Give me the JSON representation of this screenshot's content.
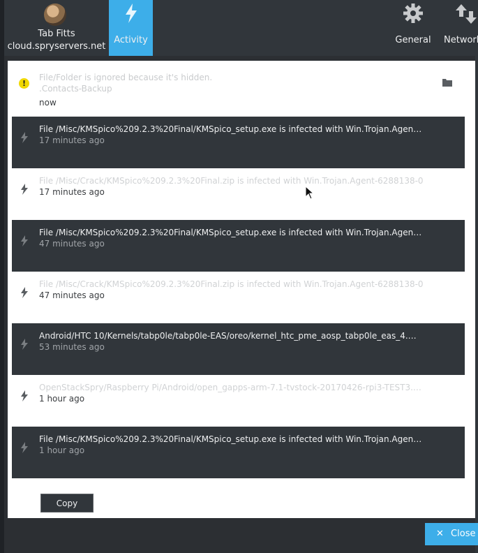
{
  "toolbar": {
    "account_name": "Tab Fitts",
    "account_host": "cloud.spryservers.net",
    "activity_label": "Activity",
    "general_label": "General",
    "network_label": "Network"
  },
  "notice": {
    "line1": "File/Folder is ignored because it's hidden.",
    "line2": ".Contacts-Backup",
    "time": "now",
    "icon": "warning-icon"
  },
  "activities": [
    {
      "title": "File /Misc/KMSpico%209.2.3%20Final/KMSpico_setup.exe is infected with Win.Trojan.Agen…",
      "time": "17 minutes ago",
      "style": "dark"
    },
    {
      "title": "File /Misc/Crack/KMSpico%209.2.3%20Final.zip is infected with Win.Trojan.Agent-6288138-0",
      "time": "17 minutes ago",
      "style": "light"
    },
    {
      "title": "File /Misc/KMSpico%209.2.3%20Final/KMSpico_setup.exe is infected with Win.Trojan.Agen…",
      "time": "47 minutes ago",
      "style": "dark"
    },
    {
      "title": "File /Misc/Crack/KMSpico%209.2.3%20Final.zip is infected with Win.Trojan.Agent-6288138-0",
      "time": "47 minutes ago",
      "style": "light"
    },
    {
      "title": "Android/HTC 10/Kernels/tabp0le/tabp0le-EAS/oreo/kernel_htc_pme_aosp_tabp0le_eas_4.…",
      "time": "53 minutes ago",
      "style": "dark"
    },
    {
      "title": "OpenStackSpry/Raspberry Pi/Android/open_gapps-arm-7.1-tvstock-20170426-rpi3-TEST3.…",
      "time": "1 hour ago",
      "style": "light"
    },
    {
      "title": "File /Misc/KMSpico%209.2.3%20Final/KMSpico_setup.exe is infected with Win.Trojan.Agen…",
      "time": "1 hour ago",
      "style": "dark"
    }
  ],
  "buttons": {
    "copy_label": "Copy",
    "close_label": "Close"
  },
  "colors": {
    "accent": "#3daee9",
    "dark_row": "#31363b",
    "warning": "#f0d800"
  }
}
